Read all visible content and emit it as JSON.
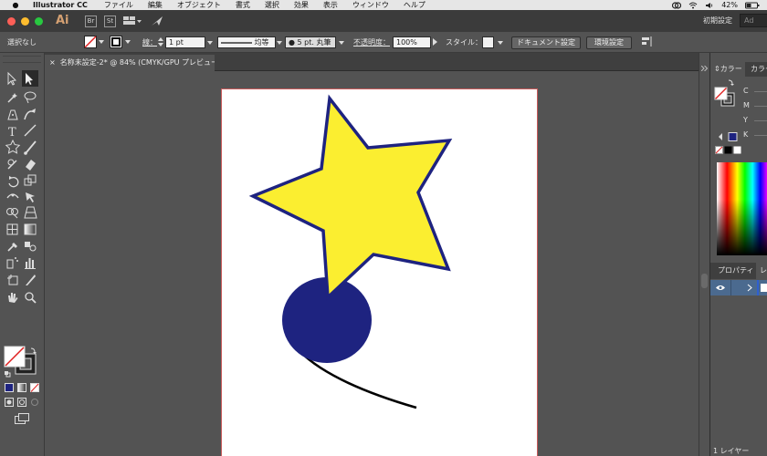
{
  "menubar": {
    "apple": "",
    "app_name": "Illustrator CC",
    "items": [
      "ファイル",
      "編集",
      "オブジェクト",
      "書式",
      "選択",
      "効果",
      "表示",
      "ウィンドウ",
      "ヘルプ"
    ],
    "battery": "42%"
  },
  "appbar": {
    "logo": "Ai",
    "st_label": "St",
    "workspace": "初期設定",
    "search_placeholder": "Ad"
  },
  "control": {
    "selection_status": "選択なし",
    "stroke_label": "線：",
    "stroke_weight": "1 pt",
    "stroke_profile": "均等",
    "brush": "5 pt. 丸筆",
    "opacity_label": "不透明度：",
    "opacity_value": "100%",
    "style_label": "スタイル：",
    "doc_setup_button": "ドキュメント設定",
    "preferences_button": "環境設定"
  },
  "document": {
    "tab_title": "名称未設定-2* @ 84% (CMYK/GPU プレビュー)",
    "close_glyph": "×"
  },
  "panels": {
    "color_tab": "カラー",
    "color_guide_tab": "カラー",
    "cmyk": [
      "C",
      "M",
      "Y",
      "K"
    ],
    "properties_tab": "プロパティ",
    "layers_tab": "レ",
    "layers_count": "1 レイヤー"
  },
  "colors": {
    "star_fill": "#fbee30",
    "navy": "#1e2380",
    "accent_stroke": "#c85a5a"
  }
}
